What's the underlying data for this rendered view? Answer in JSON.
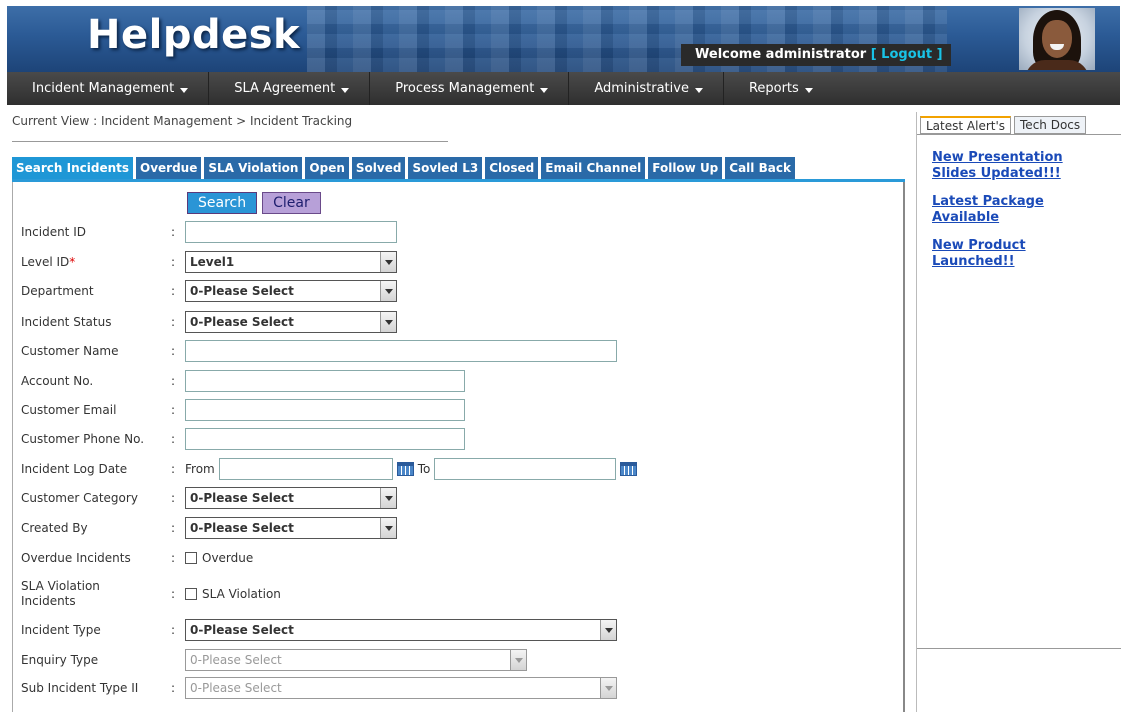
{
  "header": {
    "logo": "Helpdesk",
    "welcome": "Welcome administrator",
    "logout": "[ Logout ]"
  },
  "nav": [
    {
      "label": "Incident Management"
    },
    {
      "label": "SLA Agreement"
    },
    {
      "label": "Process Management"
    },
    {
      "label": "Administrative"
    },
    {
      "label": "Reports"
    }
  ],
  "breadcrumb": "Current View : Incident Management > Incident Tracking",
  "tabs": [
    {
      "label": "Search Incidents",
      "active": true
    },
    {
      "label": "Overdue"
    },
    {
      "label": "SLA Violation"
    },
    {
      "label": "Open"
    },
    {
      "label": "Solved"
    },
    {
      "label": "Sovled L3"
    },
    {
      "label": "Closed"
    },
    {
      "label": "Email Channel"
    },
    {
      "label": "Follow Up"
    },
    {
      "label": "Call Back"
    }
  ],
  "buttons": {
    "search": "Search",
    "clear": "Clear"
  },
  "form": {
    "incident_id": {
      "label": "Incident ID",
      "value": ""
    },
    "level_id": {
      "label": "Level ID",
      "required": "*",
      "value": "Level1"
    },
    "department": {
      "label": "Department",
      "value": "0-Please Select"
    },
    "incident_status": {
      "label": "Incident Status",
      "value": "0-Please Select"
    },
    "customer_name": {
      "label": "Customer Name",
      "value": ""
    },
    "account_no": {
      "label": "Account No.",
      "value": ""
    },
    "customer_email": {
      "label": "Customer Email",
      "value": ""
    },
    "customer_phone": {
      "label": "Customer Phone No.",
      "value": ""
    },
    "incident_log_date": {
      "label": "Incident Log Date",
      "from": "From",
      "to": "To",
      "from_value": "",
      "to_value": ""
    },
    "customer_category": {
      "label": "Customer Category",
      "value": "0-Please Select"
    },
    "created_by": {
      "label": "Created By",
      "value": "0-Please Select"
    },
    "overdue": {
      "label": "Overdue Incidents",
      "checkbox": "Overdue",
      "checked": false
    },
    "sla_violation": {
      "label": "SLA Violation Incidents",
      "checkbox": "SLA Violation",
      "checked": false
    },
    "incident_type": {
      "label": "Incident Type",
      "value": "0-Please Select"
    },
    "enquiry_type": {
      "label": "Enquiry Type",
      "value": "0-Please Select"
    },
    "sub_incident_type": {
      "label": "Sub Incident Type II",
      "value": "0-Please Select"
    }
  },
  "sidebar": {
    "tabs": [
      {
        "label": "Latest Alert's",
        "active": true
      },
      {
        "label": "Tech Docs"
      }
    ],
    "alerts": [
      "New Presentation Slides Updated!!!",
      "Latest Package Available",
      "New Product Launched!!"
    ]
  },
  "colors": {
    "tab_blue": "#2a6aa8",
    "tab_active": "#1f97d6",
    "nav_bg": "#333333",
    "link": "#1a4ab8",
    "logout": "#19c3e6"
  }
}
